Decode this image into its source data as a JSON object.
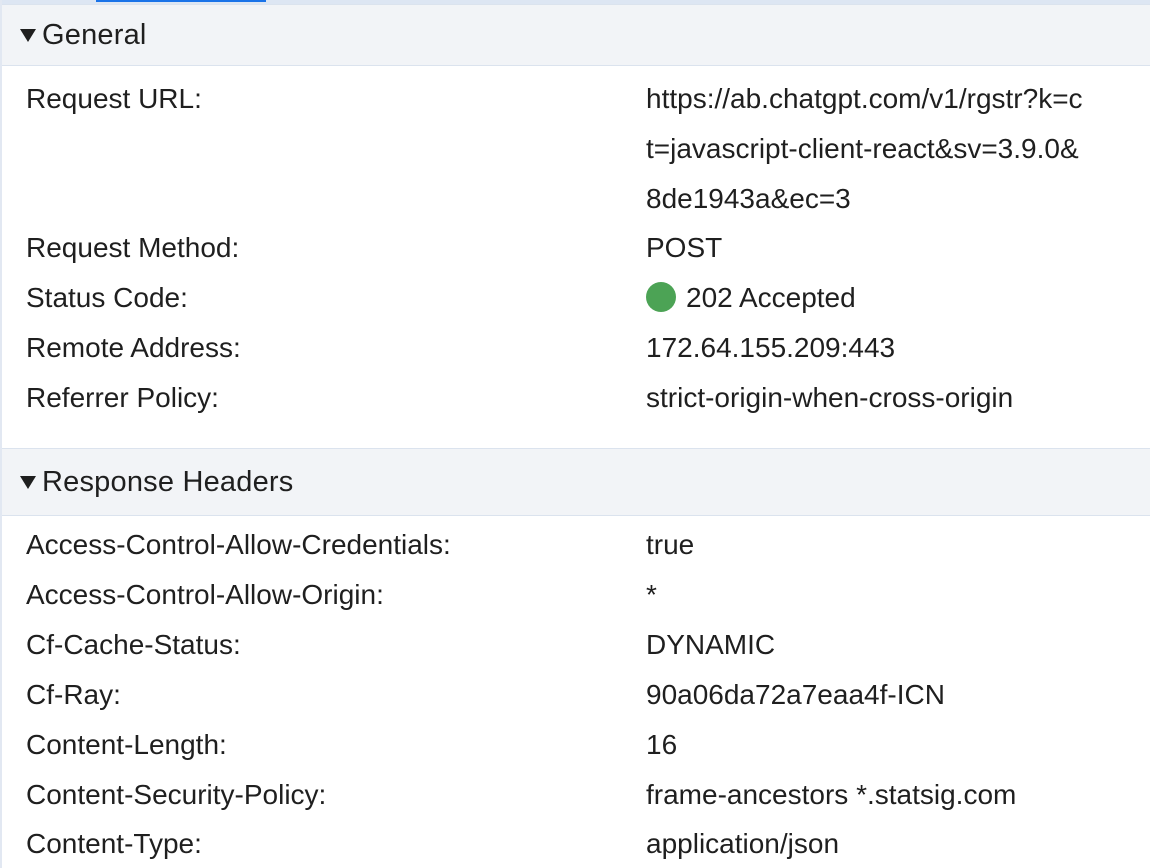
{
  "general": {
    "title": "General",
    "request_url_label": "Request URL:",
    "request_url_lines": [
      "https://ab.chatgpt.com/v1/rgstr?k=c",
      "t=javascript-client-react&sv=3.9.0&",
      "8de1943a&ec=3"
    ],
    "request_method_label": "Request Method:",
    "request_method_value": "POST",
    "status_code_label": "Status Code:",
    "status_code_value": "202 Accepted",
    "status_color": "#4ca355",
    "remote_address_label": "Remote Address:",
    "remote_address_value": "172.64.155.209:443",
    "referrer_policy_label": "Referrer Policy:",
    "referrer_policy_value": "strict-origin-when-cross-origin"
  },
  "response_headers": {
    "title": "Response Headers",
    "rows": [
      {
        "name": "Access-Control-Allow-Credentials:",
        "value": "true"
      },
      {
        "name": "Access-Control-Allow-Origin:",
        "value": "*"
      },
      {
        "name": "Cf-Cache-Status:",
        "value": "DYNAMIC"
      },
      {
        "name": "Cf-Ray:",
        "value": "90a06da72a7eaa4f-ICN"
      },
      {
        "name": "Content-Length:",
        "value": "16"
      },
      {
        "name": "Content-Security-Policy:",
        "value": "frame-ancestors *.statsig.com"
      },
      {
        "name": "Content-Type:",
        "value": "application/json"
      }
    ]
  },
  "icons": {
    "collapse": "triangle-down-icon",
    "status": "status-dot-icon"
  }
}
